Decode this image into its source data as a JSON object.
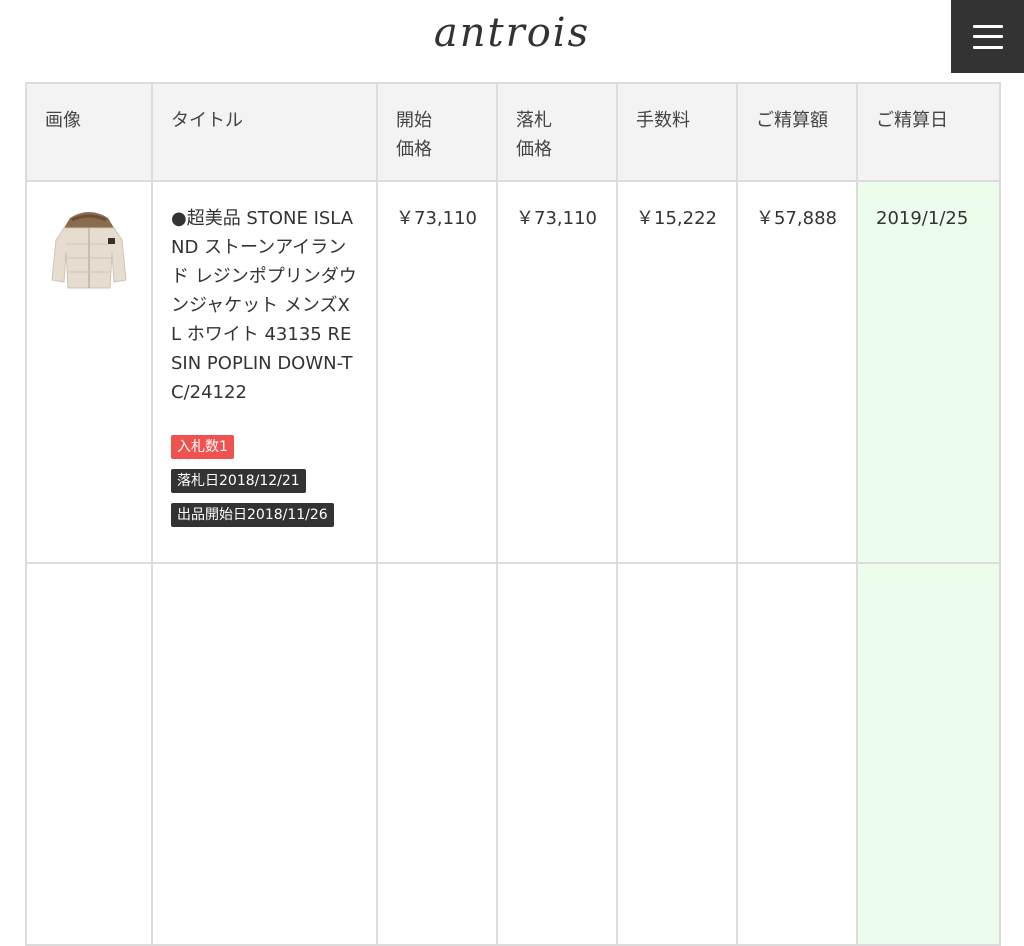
{
  "header": {
    "logo": "antrois",
    "menu_icon": "hamburger-icon"
  },
  "table": {
    "columns": [
      {
        "label": "画像"
      },
      {
        "label": "タイトル"
      },
      {
        "label": "開始\n価格"
      },
      {
        "label": "落札\n価格"
      },
      {
        "label": "手数料"
      },
      {
        "label": "ご精算額"
      },
      {
        "label": "ご精算日"
      }
    ],
    "rows": [
      {
        "image": "down-jacket-thumbnail",
        "title": "●超美品 STONE ISLAND ストーンアイランド レジンポプリンダウンジャケット メンズXL ホワイト 43135 RESIN POPLIN DOWN-TC/24122",
        "bids": "入札数1",
        "won_date": "落札日2018/12/21",
        "listing_date": "出品開始日2018/11/26",
        "start_price": "￥73,110",
        "winning_price": "￥73,110",
        "fee": "￥15,222",
        "settlement_amount": "￥57,888",
        "settlement_date": "2019/1/25"
      }
    ]
  },
  "colors": {
    "header_bg": "#f3f3f3",
    "border": "#dcdcdc",
    "paid_date_bg": "#ecfdec",
    "bids_badge": "#ef5350",
    "dark_badge": "#333333",
    "menu_button": "#333333"
  }
}
